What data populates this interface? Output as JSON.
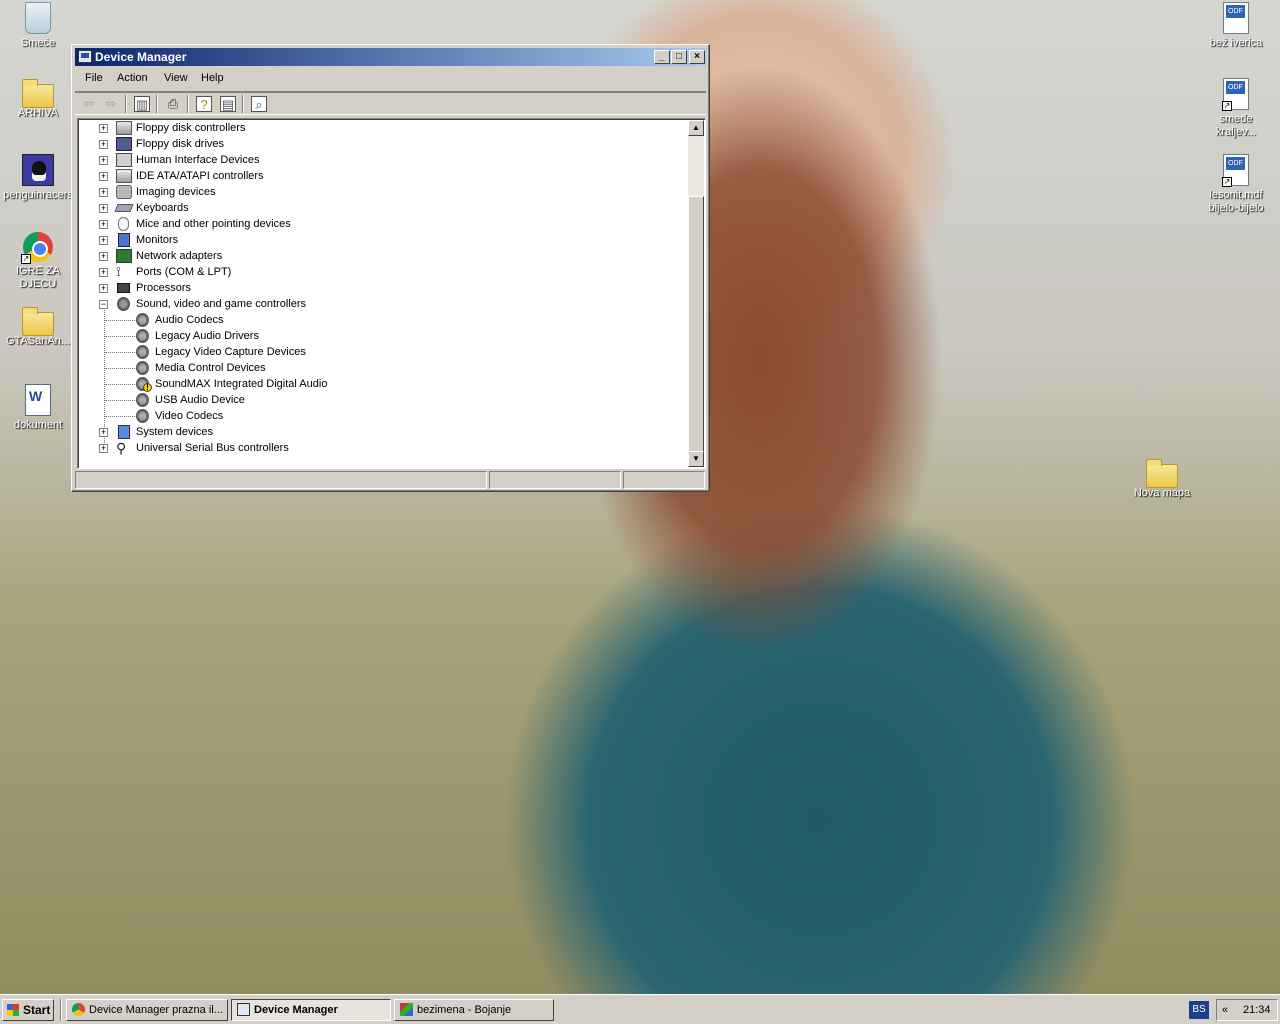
{
  "desktop": {
    "icons_left": [
      {
        "label": "Smeće",
        "icon": "recycle-bin-icon"
      },
      {
        "label": "ARHIVA",
        "icon": "folder-icon"
      },
      {
        "label": "penguinracers",
        "icon": "penguin-icon"
      },
      {
        "label": "IGRE ZA DJECU",
        "icon": "chrome-icon"
      },
      {
        "label": "GTASanAn...",
        "icon": "folder-icon"
      },
      {
        "label": "dokument",
        "icon": "word-document-icon"
      }
    ],
    "icons_right": [
      {
        "label": "bež iverica",
        "icon": "odf-document-icon",
        "tag": "ODF"
      },
      {
        "label": "smeđe kraljev...",
        "icon": "odf-shortcut-icon",
        "tag": "ODF"
      },
      {
        "label": "lesonit,mdf bijelo-bijelo",
        "icon": "odf-shortcut-icon",
        "tag": "ODF"
      },
      {
        "label": "Nova mapa",
        "icon": "folder-icon"
      }
    ]
  },
  "window": {
    "title": "Device Manager",
    "controls": {
      "minimize": "_",
      "maximize": "□",
      "close": "×"
    },
    "menu": [
      "File",
      "Action",
      "View",
      "Help"
    ],
    "toolbar": [
      "back-icon",
      "forward-icon",
      "show-hide-console-tree-icon",
      "print-icon",
      "properties-icon",
      "help-icon",
      "scan-hardware-icon"
    ],
    "tree": [
      {
        "label": "Floppy disk controllers",
        "icon": "disk-controller-icon",
        "expander": "+"
      },
      {
        "label": "Floppy disk drives",
        "icon": "floppy-drive-icon",
        "expander": "+"
      },
      {
        "label": "Human Interface Devices",
        "icon": "hid-icon",
        "expander": "+"
      },
      {
        "label": "IDE ATA/ATAPI controllers",
        "icon": "ide-controller-icon",
        "expander": "+"
      },
      {
        "label": "Imaging devices",
        "icon": "imaging-icon",
        "expander": "+"
      },
      {
        "label": "Keyboards",
        "icon": "keyboard-icon",
        "expander": "+"
      },
      {
        "label": "Mice and other pointing devices",
        "icon": "mouse-icon",
        "expander": "+"
      },
      {
        "label": "Monitors",
        "icon": "monitor-icon",
        "expander": "+"
      },
      {
        "label": "Network adapters",
        "icon": "network-adapter-icon",
        "expander": "+"
      },
      {
        "label": "Ports (COM & LPT)",
        "icon": "port-icon",
        "expander": "+"
      },
      {
        "label": "Processors",
        "icon": "processor-icon",
        "expander": "+"
      },
      {
        "label": "Sound, video and game controllers",
        "icon": "sound-icon",
        "expander": "−"
      },
      {
        "label": "Audio Codecs",
        "icon": "sound-device-icon",
        "child": true
      },
      {
        "label": "Legacy Audio Drivers",
        "icon": "sound-device-icon",
        "child": true
      },
      {
        "label": "Legacy Video Capture Devices",
        "icon": "sound-device-icon",
        "child": true
      },
      {
        "label": "Media Control Devices",
        "icon": "sound-device-icon",
        "child": true
      },
      {
        "label": "SoundMAX Integrated Digital Audio",
        "icon": "warning-sound-device-icon",
        "child": true,
        "warning": true
      },
      {
        "label": "USB Audio Device",
        "icon": "sound-device-icon",
        "child": true
      },
      {
        "label": "Video Codecs",
        "icon": "sound-device-icon",
        "child": true
      },
      {
        "label": "System devices",
        "icon": "system-device-icon",
        "expander": "+"
      },
      {
        "label": "Universal Serial Bus controllers",
        "icon": "usb-icon",
        "expander": "+"
      }
    ]
  },
  "taskbar": {
    "start_label": "Start",
    "tasks": [
      {
        "label": "Device Manager prazna il...",
        "icon": "chrome-icon",
        "active": false
      },
      {
        "label": "Device Manager",
        "icon": "device-manager-icon",
        "active": true
      },
      {
        "label": "bezimena - Bojanje",
        "icon": "paint-icon",
        "active": false
      }
    ],
    "language": "BS",
    "clock": "21:34",
    "tray_chevron": "«"
  },
  "colors": {
    "titlebar_start": "#0a246a",
    "titlebar_end": "#a6caf0",
    "chrome_face": "#d4d0c8"
  }
}
